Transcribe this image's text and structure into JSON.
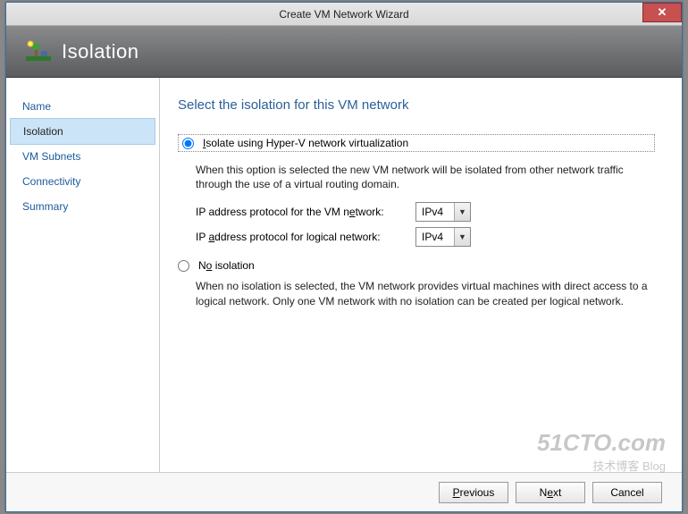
{
  "window": {
    "title": "Create VM Network Wizard"
  },
  "banner": {
    "title": "Isolation"
  },
  "sidebar": {
    "steps": [
      {
        "label": "Name",
        "active": false
      },
      {
        "label": "Isolation",
        "active": true
      },
      {
        "label": "VM Subnets",
        "active": false
      },
      {
        "label": "Connectivity",
        "active": false
      },
      {
        "label": "Summary",
        "active": false
      }
    ]
  },
  "content": {
    "heading": "Select the isolation for this VM network",
    "option_hyperv": {
      "label_pre": "",
      "label_mn": "I",
      "label_post": "solate using Hyper-V network virtualization",
      "selected": true,
      "desc": "When this option is selected the new VM network will be isolated from other network traffic through the use of a virtual routing domain.",
      "vm_protocol_label_pre": "IP address protocol for the VM n",
      "vm_protocol_label_mn": "e",
      "vm_protocol_label_post": "twork:",
      "vm_protocol_value": "IPv4",
      "logical_protocol_label_pre": "IP ",
      "logical_protocol_label_mn": "a",
      "logical_protocol_label_post": "ddress protocol for logical network:",
      "logical_protocol_value": "IPv4"
    },
    "option_none": {
      "label_pre": "N",
      "label_mn": "o",
      "label_post": " isolation",
      "selected": false,
      "desc": "When no isolation is selected, the VM network provides virtual machines with direct access to a logical network. Only one VM network with no isolation can be created per logical network."
    }
  },
  "footer": {
    "previous_mn": "P",
    "previous_post": "revious",
    "next_pre": "N",
    "next_mn": "e",
    "next_post": "xt",
    "cancel": "Cancel"
  },
  "watermark": {
    "main": "51CTO.com",
    "sub": "技术博客  Blog"
  }
}
